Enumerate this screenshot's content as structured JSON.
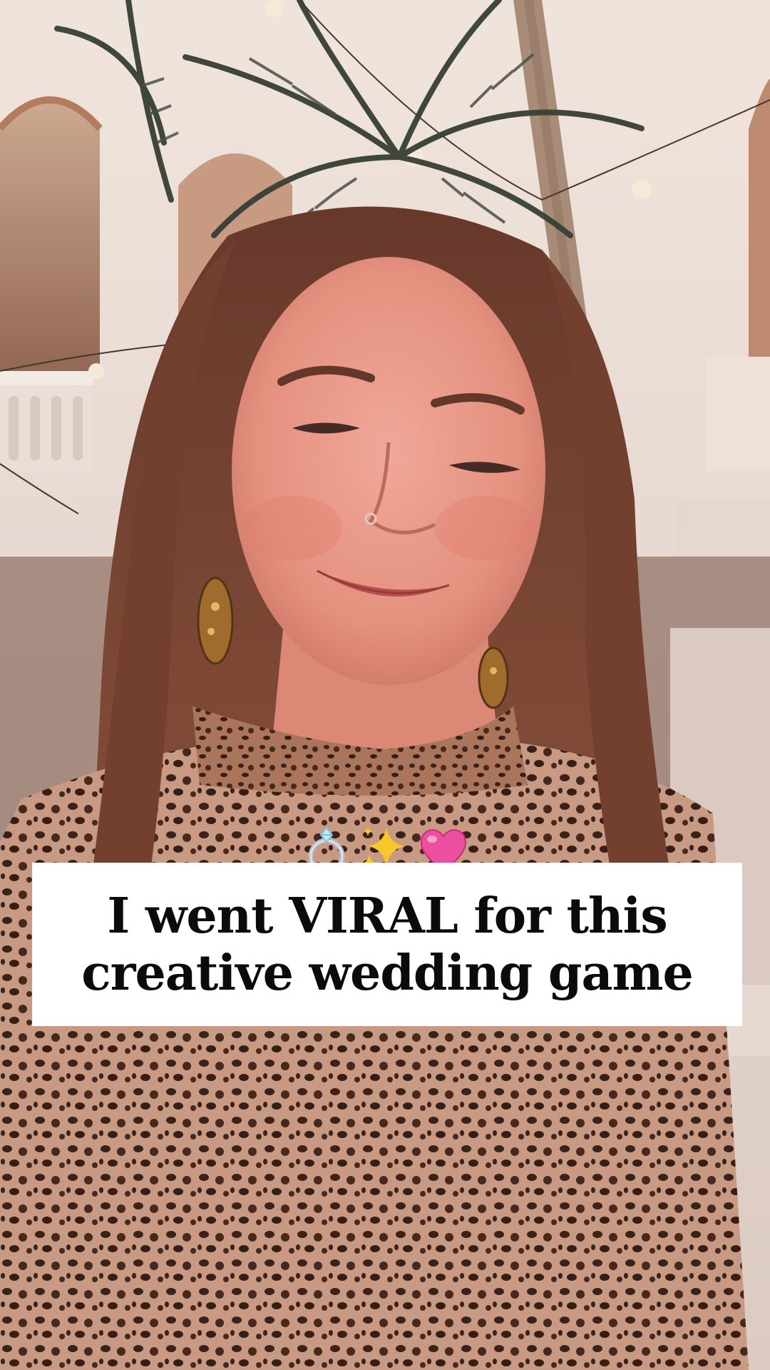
{
  "scene": {
    "description_icon": "selfie-photo-background"
  },
  "overlay": {
    "emojis": [
      "ring-icon",
      "sparkles-icon",
      "pink-heart-icon"
    ],
    "caption_lines": [
      "I went VIRAL for this",
      "creative wedding game"
    ]
  },
  "colors": {
    "caption_bg": "#ffffff",
    "caption_text": "#0b0b0b"
  }
}
